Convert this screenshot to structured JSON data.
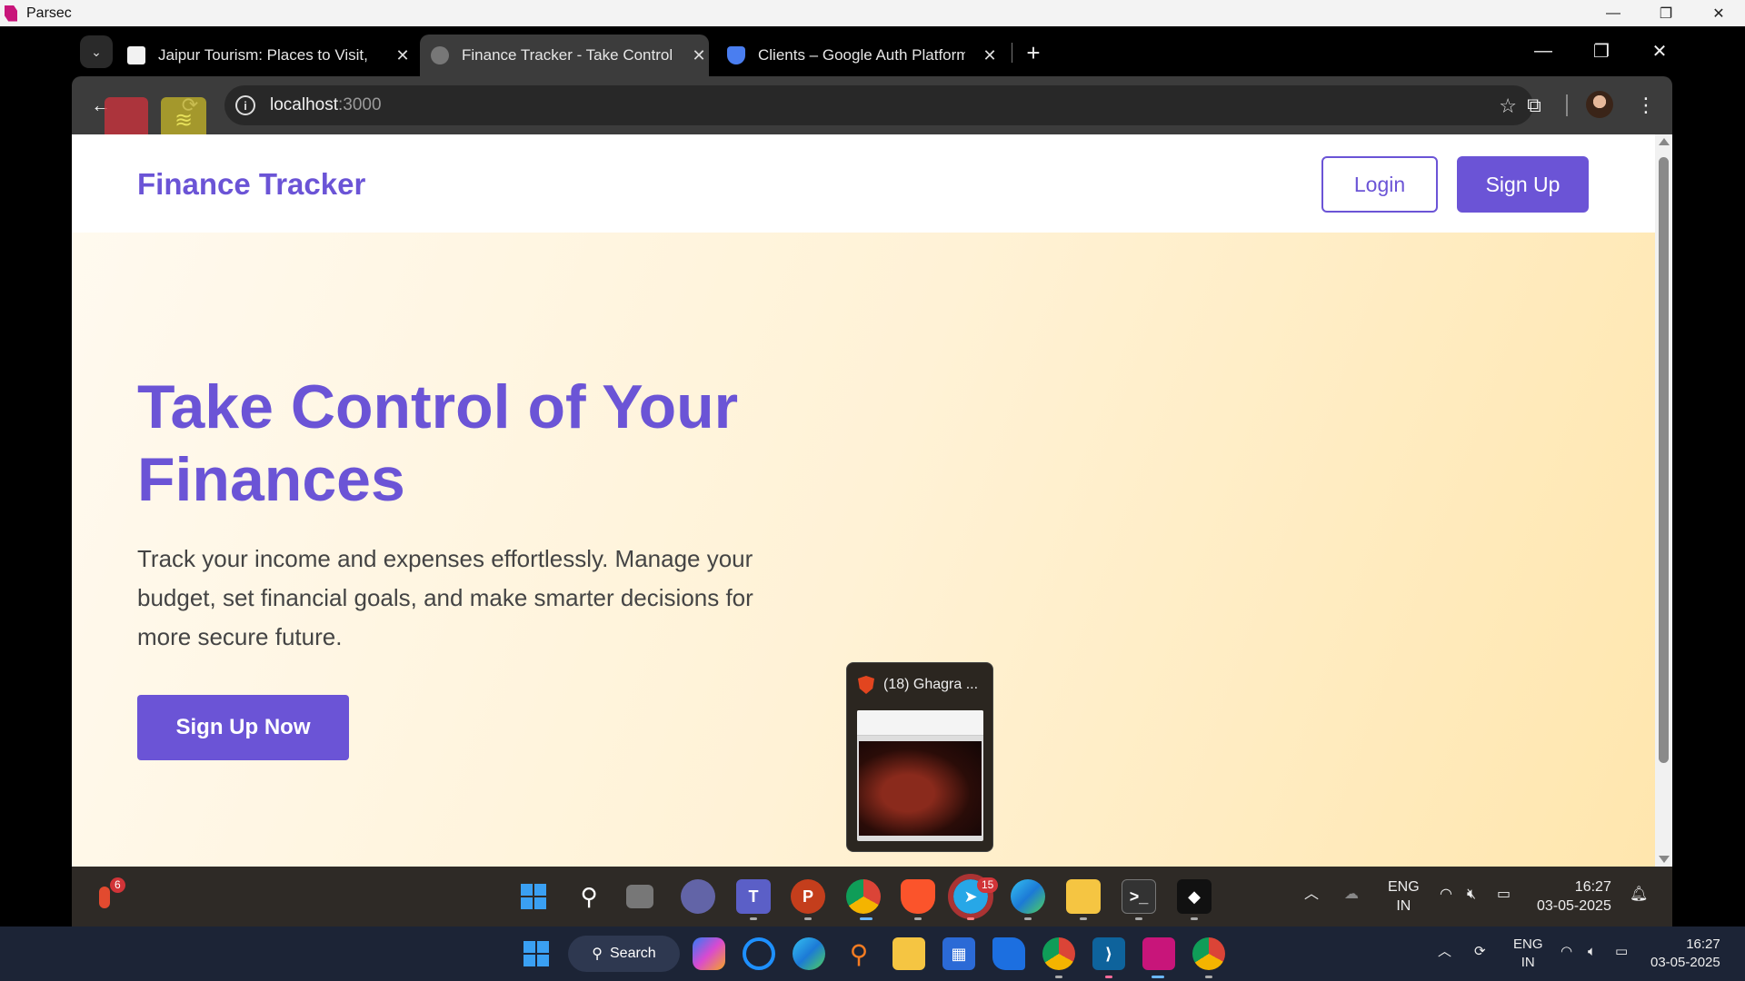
{
  "parsec": {
    "title": "Parsec",
    "minimize": "—",
    "maximize": "❐",
    "close": "✕"
  },
  "tabs": [
    {
      "title": "Jaipur Tourism: Places to Visit, S",
      "close": "✕"
    },
    {
      "title": "Finance Tracker - Take Control o",
      "close": "✕"
    },
    {
      "title": "Clients – Google Auth Platform",
      "close": "✕"
    }
  ],
  "tab_search_icon": "⌄",
  "new_tab": "+",
  "chrome_window": {
    "minimize": "—",
    "maximize": "❐",
    "close": "✕"
  },
  "address_bar": {
    "host": "localhost",
    "port": ":3000"
  },
  "toolbar_icons": {
    "back": "←",
    "reload": "⟳",
    "star": "☆",
    "extensions": "⧉",
    "menu": "⋮",
    "info": "i"
  },
  "page": {
    "brand": "Finance Tracker",
    "login_label": "Login",
    "signup_label": "Sign Up",
    "hero_title": "Take Control of Your Finances",
    "hero_text": "Track your income and expenses effortlessly. Manage your budget, set financial goals, and make smarter decisions for more secure future.",
    "cta_label": "Sign Up Now",
    "brand_color": "#6b54d6"
  },
  "preview": {
    "title": "(18) Ghagra ..."
  },
  "remote_taskbar": {
    "weather_badge": "6",
    "telegram_badge": "15",
    "lang_line1": "ENG",
    "lang_line2": "IN",
    "time": "16:27",
    "date": "03-05-2025"
  },
  "local_taskbar": {
    "search_label": "Search",
    "lang_line1": "ENG",
    "lang_line2": "IN",
    "time": "16:27",
    "date": "03-05-2025"
  }
}
